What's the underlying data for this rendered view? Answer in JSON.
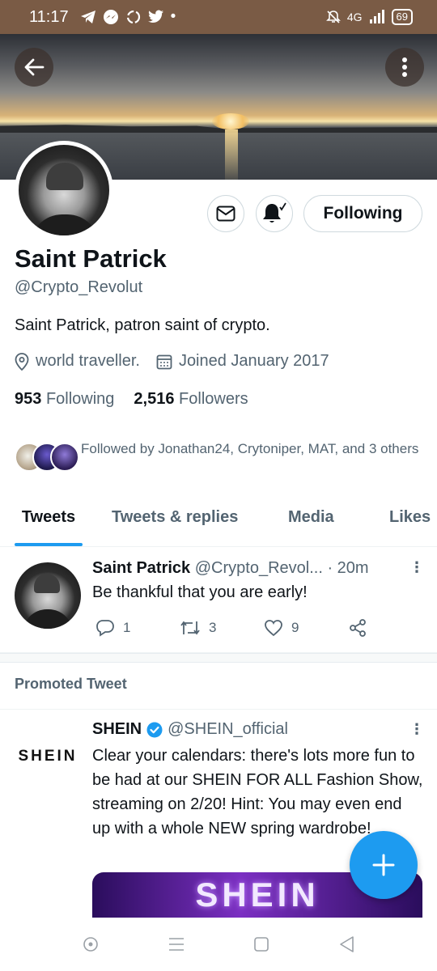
{
  "status_bar": {
    "time": "11:17",
    "network": "4G",
    "battery": "69"
  },
  "profile": {
    "name": "Saint Patrick",
    "handle": "@Crypto_Revolut",
    "bio": "Saint Patrick, patron saint of crypto.",
    "location": "world traveller.",
    "joined": "Joined January 2017",
    "following_count": "953",
    "following_label": "Following",
    "followers_count": "2,516",
    "followers_label": "Followers",
    "followed_by": "Followed by Jonathan24, Crytoniper, MAT, and 3 others",
    "follow_button": "Following"
  },
  "tabs": [
    "Tweets",
    "Tweets & replies",
    "Media",
    "Likes"
  ],
  "tweet": {
    "name": "Saint Patrick",
    "handle": "@Crypto_Revol...",
    "time": "· 20m",
    "text": "Be thankful that you are early!",
    "replies": "1",
    "retweets": "3",
    "likes": "9"
  },
  "promoted": {
    "label": "Promoted Tweet",
    "avatar_text": "SHEIN",
    "name": "SHEIN",
    "handle": "@SHEIN_official",
    "text": "Clear your calendars: there's lots more fun to be had at our SHEIN FOR ALL Fashion Show, streaming on 2/20! Hint: You may even end up with a whole NEW spring wardrobe!",
    "media_text": "SHEIN"
  },
  "colors": {
    "accent": "#1d9bf0",
    "text": "#0f1419",
    "secondary": "#536471",
    "status_bar": "#7a5b45"
  }
}
